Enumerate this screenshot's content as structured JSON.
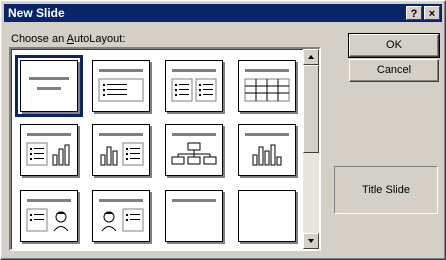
{
  "window": {
    "title": "New Slide",
    "help_label": "?",
    "close_label": "×"
  },
  "label": {
    "prefix": "Choose an ",
    "accel": "A",
    "suffix": "utoLayout:"
  },
  "buttons": {
    "ok": "OK",
    "cancel": "Cancel"
  },
  "preview": {
    "caption": "Title Slide"
  },
  "layouts": [
    {
      "id": "title-slide",
      "selected": true
    },
    {
      "id": "bulleted-list"
    },
    {
      "id": "two-column-text"
    },
    {
      "id": "table"
    },
    {
      "id": "text-and-chart"
    },
    {
      "id": "chart-and-text"
    },
    {
      "id": "organization-chart"
    },
    {
      "id": "chart"
    },
    {
      "id": "text-and-clip-art"
    },
    {
      "id": "clip-art-and-text"
    },
    {
      "id": "title-only"
    },
    {
      "id": "blank"
    }
  ],
  "colors": {
    "titlebar": "#0a246a",
    "face": "#d4d0c8"
  }
}
